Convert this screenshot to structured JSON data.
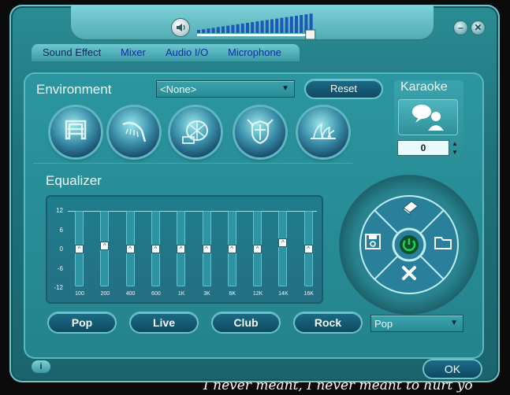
{
  "background_text": "I never meant, I never meant to hurt yo",
  "window": {
    "volume_level": 0.97,
    "min_icon": "minimize-icon",
    "close_icon": "close-icon"
  },
  "tabs": [
    {
      "label": "Sound Effect",
      "active": true
    },
    {
      "label": "Mixer",
      "active": false
    },
    {
      "label": "Audio I/O",
      "active": false
    },
    {
      "label": "Microphone",
      "active": false
    }
  ],
  "environment": {
    "label": "Environment",
    "selected": "<None>",
    "reset_label": "Reset",
    "presets": [
      "bathroom-icon",
      "shower-icon",
      "stadium-icon",
      "shield-icon",
      "opera-house-icon"
    ]
  },
  "karaoke": {
    "label": "Karaoke",
    "value": "0",
    "icon": "speaking-person-icon"
  },
  "equalizer": {
    "label": "Equalizer",
    "y_ticks": [
      "12",
      "6",
      "0",
      "-6",
      "-12"
    ],
    "bands": [
      {
        "label": "100",
        "db": 0
      },
      {
        "label": "200",
        "db": 1
      },
      {
        "label": "400",
        "db": 0
      },
      {
        "label": "600",
        "db": 0
      },
      {
        "label": "1K",
        "db": 0
      },
      {
        "label": "3K",
        "db": 0
      },
      {
        "label": "6K",
        "db": 0
      },
      {
        "label": "12K",
        "db": 0
      },
      {
        "label": "14K",
        "db": 2
      },
      {
        "label": "16K",
        "db": 0
      }
    ],
    "presets": [
      "Pop",
      "Live",
      "Club",
      "Rock"
    ],
    "preset_selected": "Pop"
  },
  "controller": {
    "icons": [
      "eraser-icon",
      "save-icon",
      "power-icon",
      "folder-icon",
      "delete-icon"
    ],
    "accent": "#1fd05a"
  },
  "footer": {
    "info_label": "i",
    "ok_label": "OK"
  }
}
